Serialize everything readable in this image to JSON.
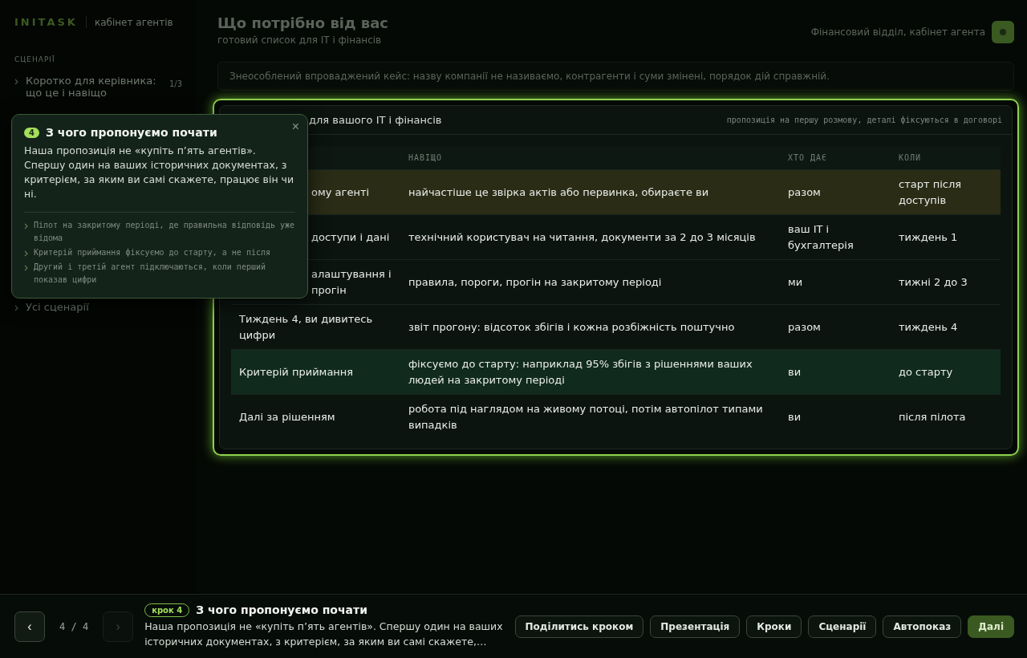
{
  "sidebar": {
    "logo": "INITASK",
    "subtitle": "кабінет агентів",
    "section_label": "СЦЕНАРІЇ",
    "items": [
      {
        "label": "Коротко для керівника: що це і навіщо",
        "count": "1/3"
      },
      {
        "label": "Усі сценарії"
      }
    ]
  },
  "header": {
    "title": "Що потрібно від вас",
    "subtitle": "готовий список для IT і фінансів",
    "context": "Фінансовий відділ, кабінет агента"
  },
  "notice": "Знеособлений впроваджений кейс: назву компанії не називаємо, контрагенти і суми змінені, порядок дій справжній.",
  "table_card": {
    "title": "для вашого IT і фінансів",
    "note": "пропозиція на першу розмову, деталі фіксуються в договорі",
    "columns": [
      "",
      "НАВІЩО",
      "ХТО ДАЄ",
      "КОЛИ"
    ],
    "rows": [
      {
        "cells": [
          "ому агенті",
          "найчастіше це звірка актів або первинка, обираєте ви",
          "разом",
          "старт після доступів"
        ],
        "selected": true,
        "emphasized": false,
        "partial": true
      },
      {
        "cells": [
          "доступи і дані",
          "технічний користувач на читання, документи за 2 до 3 місяців",
          "ваш IT і бухгалтерія",
          "тиждень 1"
        ],
        "selected": false,
        "emphasized": false,
        "partial": true
      },
      {
        "cells": [
          "алаштування і прогін",
          "правила, пороги, прогін на закритому періоді",
          "ми",
          "тижні 2 до 3"
        ],
        "selected": false,
        "emphasized": false,
        "partial": true
      },
      {
        "cells": [
          "Тиждень 4, ви дивитесь цифри",
          "звіт прогону: відсоток збігів і кожна розбіжність поштучно",
          "разом",
          "тиждень 4"
        ],
        "selected": false,
        "emphasized": false,
        "partial": false
      },
      {
        "cells": [
          "Критерій приймання",
          "фіксуємо до старту: наприклад 95% збігів з рішеннями ваших людей на закритому періоді",
          "ви",
          "до старту"
        ],
        "selected": false,
        "emphasized": true,
        "partial": false
      },
      {
        "cells": [
          "Далі за рішенням",
          "робота під наглядом на живому потоці, потім автопілот типами випадків",
          "ви",
          "після пілота"
        ],
        "selected": false,
        "emphasized": false,
        "partial": false
      }
    ]
  },
  "popup": {
    "step": "4",
    "title": "З чого пропонуємо почати",
    "close": "×",
    "body": "Наша пропозиція не «купіть п’ять агентів». Спершу один на ваших історичних документах, з критерієм, за яким ви самі скажете, працює він чи ні.",
    "bullets": [
      "Пілот на закритому періоді, де правильна відповідь уже відома",
      "Критерій приймання фіксуємо до старту, а не після",
      "Другий і третій агент підключаються, коли перший показав цифри"
    ]
  },
  "bottom_bar": {
    "prev": "‹",
    "counter": "4 / 4",
    "next": "›",
    "next_disabled": true,
    "step_badge": "крок 4",
    "title": "З чого пропонуємо почати",
    "body": "Наша пропозиція не «купіть п’ять агентів». Спершу один на ваших історичних документах, з критерієм, за яким ви самі скажете,…",
    "buttons": [
      {
        "label": "Поділитись кроком",
        "primary": false
      },
      {
        "label": "Презентація",
        "primary": false
      },
      {
        "label": "Кроки",
        "primary": false
      },
      {
        "label": "Сценарії",
        "primary": false
      },
      {
        "label": "Автопоказ",
        "primary": false
      },
      {
        "label": "Далі",
        "primary": true
      }
    ]
  }
}
